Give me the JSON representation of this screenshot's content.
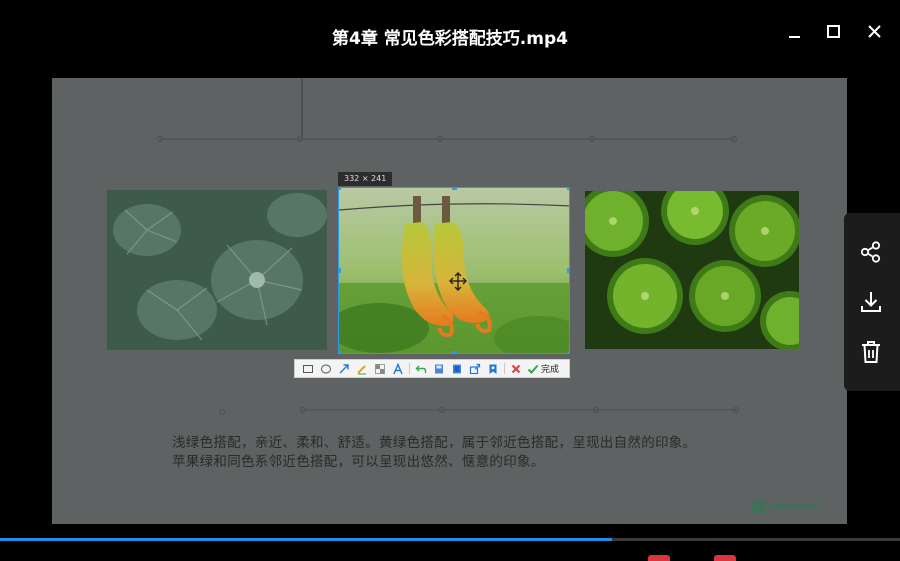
{
  "window": {
    "title": "第4章 常见色彩搭配技巧.mp4"
  },
  "slide": {
    "caption_line1": "浅绿色搭配，亲近、柔和、舒适。黄绿色搭配，属于邻近色搭配，呈现出自然的印象。",
    "caption_line2": "苹果绿和同色系邻近色搭配，可以呈现出悠然、惬意的印象。"
  },
  "screenshot_tool": {
    "size_label": "332 × 241",
    "toolbar": {
      "tools": [
        "rectangle",
        "ellipse",
        "arrow",
        "pen",
        "mosaic",
        "text",
        "undo",
        "save",
        "copy",
        "share",
        "pin",
        "cancel"
      ],
      "done_label": "完成"
    }
  },
  "side_panel": {
    "actions": [
      "share",
      "download",
      "delete"
    ]
  },
  "playback": {
    "progress": 0.68
  },
  "colors": {
    "accent": "#1e8fe6",
    "selection": "#2b9ae8",
    "cancel": "#e03b3b",
    "done": "#2fa84f"
  }
}
